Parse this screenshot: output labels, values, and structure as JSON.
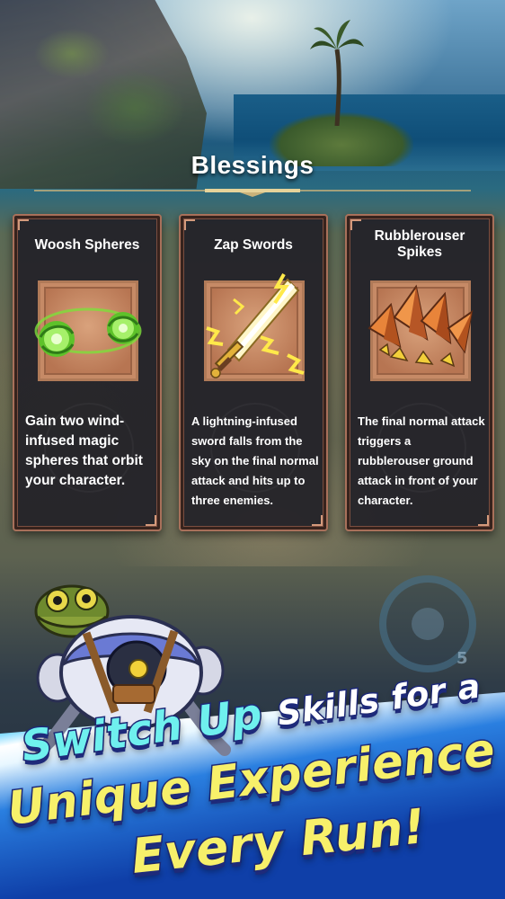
{
  "header": {
    "title": "Blessings"
  },
  "blessings": [
    {
      "name": "Woosh Spheres",
      "description": "Gain two wind-infused magic spheres that orbit your character.",
      "icon": "wind-sphere-icon"
    },
    {
      "name": "Zap Swords",
      "description": "A lightning-infused sword falls from the sky on the final normal attack and hits up to three enemies.",
      "icon": "lightning-sword-icon"
    },
    {
      "name": "Rubblerouser Spikes",
      "description": "The final normal attack triggers a rubblerouser ground attack in front of your character.",
      "icon": "rock-spikes-icon"
    }
  ],
  "hud": {
    "joystick_count": "5"
  },
  "promo": {
    "line1_big": "Switch Up",
    "line1_small": "Skills for a",
    "line2": "Unique Experience",
    "line3": "Every Run!"
  },
  "colors": {
    "card_border": "#a8705a",
    "card_bg": "#222128",
    "art_bg": "#c68a66",
    "promo_cyan": "#6ff0ee",
    "promo_yellow": "#f7f06a",
    "promo_outline": "#1e2a7a"
  }
}
